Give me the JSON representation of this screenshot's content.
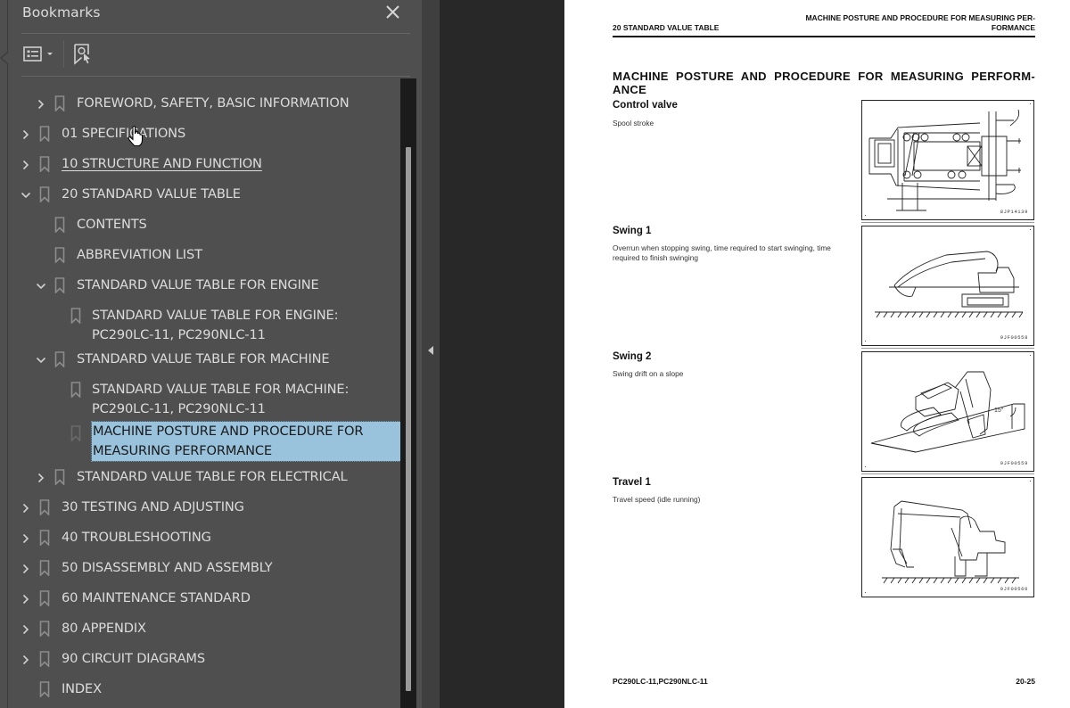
{
  "bookmarks_panel": {
    "title": "Bookmarks",
    "close_icon": "close-icon",
    "toolbar": {
      "options_icon": "bookmark-options-icon",
      "find_icon": "find-current-bookmark-icon"
    },
    "items": [
      {
        "label": "FOREWORD, SAFETY, BASIC INFORMATION",
        "level": 1,
        "expander": "collapsed"
      },
      {
        "label": "01 SPECIFICATIONS",
        "level": 0,
        "expander": "collapsed"
      },
      {
        "label": "10 STRUCTURE AND FUNCTION",
        "level": 0,
        "expander": "collapsed",
        "underlined": true
      },
      {
        "label": "20 STANDARD VALUE TABLE",
        "level": 0,
        "expander": "expanded"
      },
      {
        "label": "CONTENTS",
        "level": 1,
        "expander": "none"
      },
      {
        "label": "ABBREVIATION LIST",
        "level": 1,
        "expander": "none"
      },
      {
        "label": "STANDARD VALUE TABLE FOR ENGINE",
        "level": 1,
        "expander": "expanded"
      },
      {
        "label": "STANDARD VALUE TABLE FOR ENGINE: PC290LC-11, PC290NLC-11",
        "level": 2,
        "expander": "none"
      },
      {
        "label": "STANDARD VALUE TABLE FOR MACHINE",
        "level": 1,
        "expander": "expanded"
      },
      {
        "label": "STANDARD VALUE TABLE FOR MACHINE: PC290LC-11, PC290NLC-11",
        "level": 2,
        "expander": "none"
      },
      {
        "label": "MACHINE POSTURE AND PROCEDURE FOR MEASURING PERFORMANCE",
        "level": 2,
        "expander": "none",
        "selected": true
      },
      {
        "label": "STANDARD VALUE TABLE FOR ELECTRICAL",
        "level": 1,
        "expander": "collapsed"
      },
      {
        "label": "30 TESTING AND ADJUSTING",
        "level": 0,
        "expander": "collapsed"
      },
      {
        "label": "40 TROUBLESHOOTING",
        "level": 0,
        "expander": "collapsed"
      },
      {
        "label": "50 DISASSEMBLY AND ASSEMBLY",
        "level": 0,
        "expander": "collapsed"
      },
      {
        "label": "60 MAINTENANCE STANDARD",
        "level": 0,
        "expander": "collapsed"
      },
      {
        "label": "80 APPENDIX",
        "level": 0,
        "expander": "collapsed"
      },
      {
        "label": "90 CIRCUIT DIAGRAMS",
        "level": 0,
        "expander": "collapsed"
      },
      {
        "label": "INDEX",
        "level": 0,
        "expander": "none"
      }
    ],
    "colors": {
      "panel_bg": "#4f4f4f",
      "text": "#dcdcdc",
      "selection_bg": "#99c2dc",
      "scrollbar_track": "#1b1b1b",
      "scrollbar_thumb": "#9a9a9a"
    }
  },
  "document": {
    "header_left": "20 STANDARD VALUE TABLE",
    "header_right_line1": "MACHINE POSTURE AND PROCEDURE FOR MEASURING PER-",
    "header_right_line2": "FORMANCE",
    "title_line1": "MACHINE POSTURE AND PROCEDURE FOR MEASURING PERFORM-",
    "title_line2": "ANCE",
    "sections": [
      {
        "title": "Control valve",
        "description": "Spool stroke",
        "figure_code": "8JP14139",
        "figure": "control-valve-diagram"
      },
      {
        "title": "Swing 1",
        "description": "Overrun when stopping swing, time required to start swinging, time required to finish swinging",
        "figure_code": "9JF00558",
        "figure": "excavator-swing-diagram"
      },
      {
        "title": "Swing 2",
        "description": "Swing drift on a slope",
        "figure_code": "9JF00559",
        "figure": "excavator-slope-diagram",
        "figure_annotation": "15°"
      },
      {
        "title": "Travel 1",
        "description": "Travel speed (idle running)",
        "figure_code": "9JF00560",
        "figure": "excavator-travel-diagram"
      }
    ],
    "footer_left": "PC290LC-11,PC290NLC-11",
    "footer_right": "20-25"
  }
}
